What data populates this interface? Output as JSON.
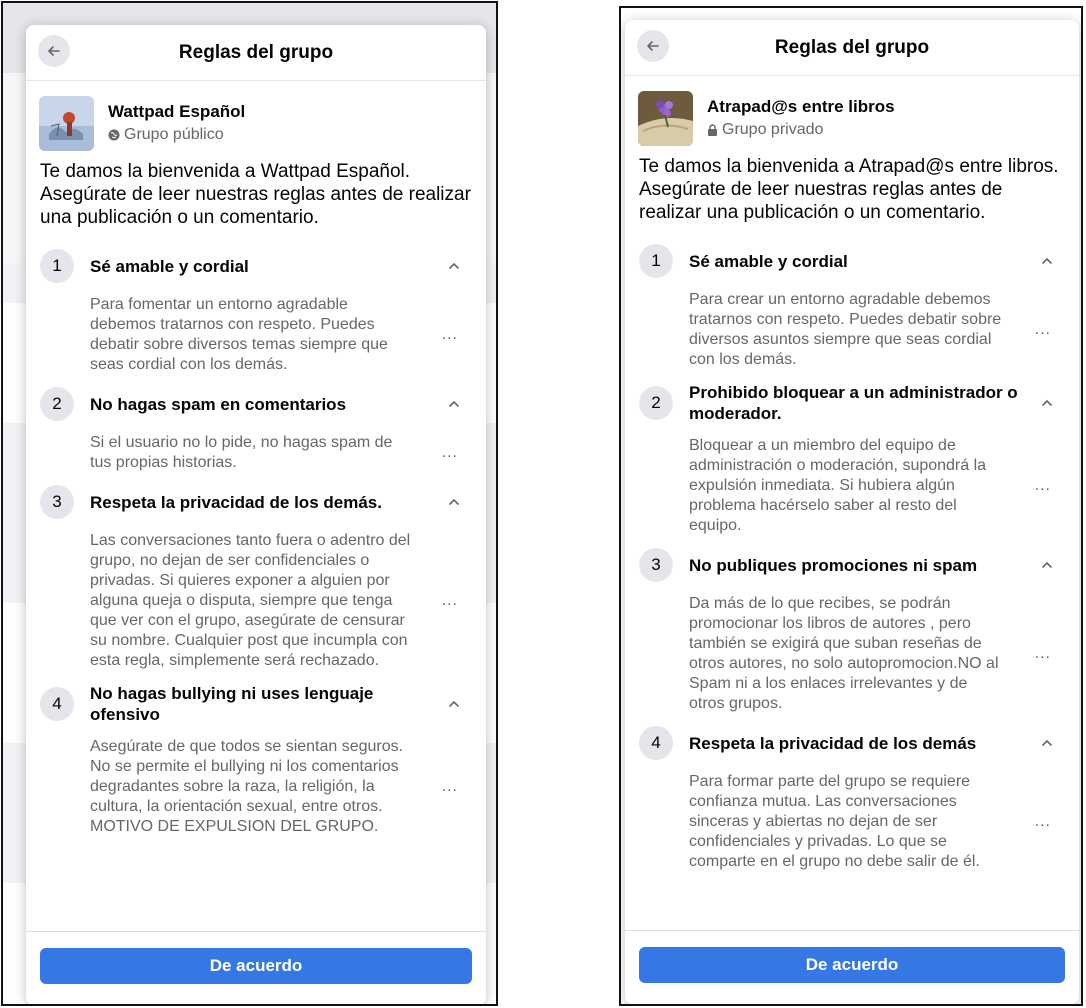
{
  "left": {
    "title": "Reglas del grupo",
    "group_name": "Wattpad Español",
    "privacy": "Grupo público",
    "intro": "Te damos la bienvenida a Wattpad Español. Asegúrate de leer nuestras reglas antes de realizar una publicación o un comentario.",
    "rules": [
      {
        "num": "1",
        "title": "Sé amable y cordial",
        "body": "Para fomentar un entorno agradable debemos tratarnos con respeto. Puedes debatir sobre diversos temas siempre que seas cordial con los demás."
      },
      {
        "num": "2",
        "title": "No hagas spam en comentarios",
        "body": "Si el usuario no lo pide, no hagas spam de tus propias historias."
      },
      {
        "num": "3",
        "title": "Respeta la privacidad de los demás.",
        "body": "Las conversaciones tanto fuera o adentro del grupo, no dejan de ser confidenciales o privadas. Si quieres exponer a alguien por alguna queja o disputa, siempre que tenga que ver con el grupo, asegúrate de censurar su nombre. Cualquier post que incumpla con esta regla, simplemente será rechazado."
      },
      {
        "num": "4",
        "title": "No hagas bullying ni uses lenguaje ofensivo",
        "body": "Asegúrate de que todos se sientan seguros. No se permite el bullying ni los comentarios degradantes sobre la raza, la religión, la cultura, la orientación sexual, entre otros. MOTIVO DE EXPULSION DEL GRUPO."
      }
    ],
    "more_label": "...",
    "button": "De acuerdo"
  },
  "right": {
    "title": "Reglas del grupo",
    "group_name": "Atrapad@s entre libros",
    "privacy": "Grupo privado",
    "intro": "Te damos la bienvenida a Atrapad@s entre libros. Asegúrate de leer nuestras reglas antes de realizar una publicación o un comentario.",
    "rules": [
      {
        "num": "1",
        "title": "Sé amable y cordial",
        "body": "Para crear un entorno agradable debemos tratarnos con respeto. Puedes debatir sobre diversos asuntos siempre que seas cordial con los demás."
      },
      {
        "num": "2",
        "title": "Prohibido bloquear a un administrador o moderador.",
        "body": "Bloquear a un miembro del equipo de administración o moderación, supondrá la expulsión inmediata. Si hubiera algún problema hacérselo saber al resto del equipo."
      },
      {
        "num": "3",
        "title": "No publiques promociones ni spam",
        "body": "Da más de lo que recibes, se podrán promocionar los libros de autores , pero también se exigirá que suban reseñas de otros autores, no solo autopromocion.NO al Spam ni a los enlaces irrelevantes y de otros grupos."
      },
      {
        "num": "4",
        "title": "Respeta la privacidad de los demás",
        "body": "Para formar parte del grupo se requiere confianza mutua. Las conversaciones sinceras y abiertas no dejan de ser confidenciales y privadas. Lo que se comparte en el grupo no debe salir de él."
      }
    ],
    "more_label": "...",
    "button": "De acuerdo"
  },
  "colors": {
    "primary_button": "#3578e5",
    "muted_text": "#65676b",
    "circle_bg": "#e4e6eb"
  },
  "icons": [
    "back-arrow-icon",
    "globe-icon",
    "lock-icon",
    "chevron-up-icon",
    "more-icon"
  ]
}
